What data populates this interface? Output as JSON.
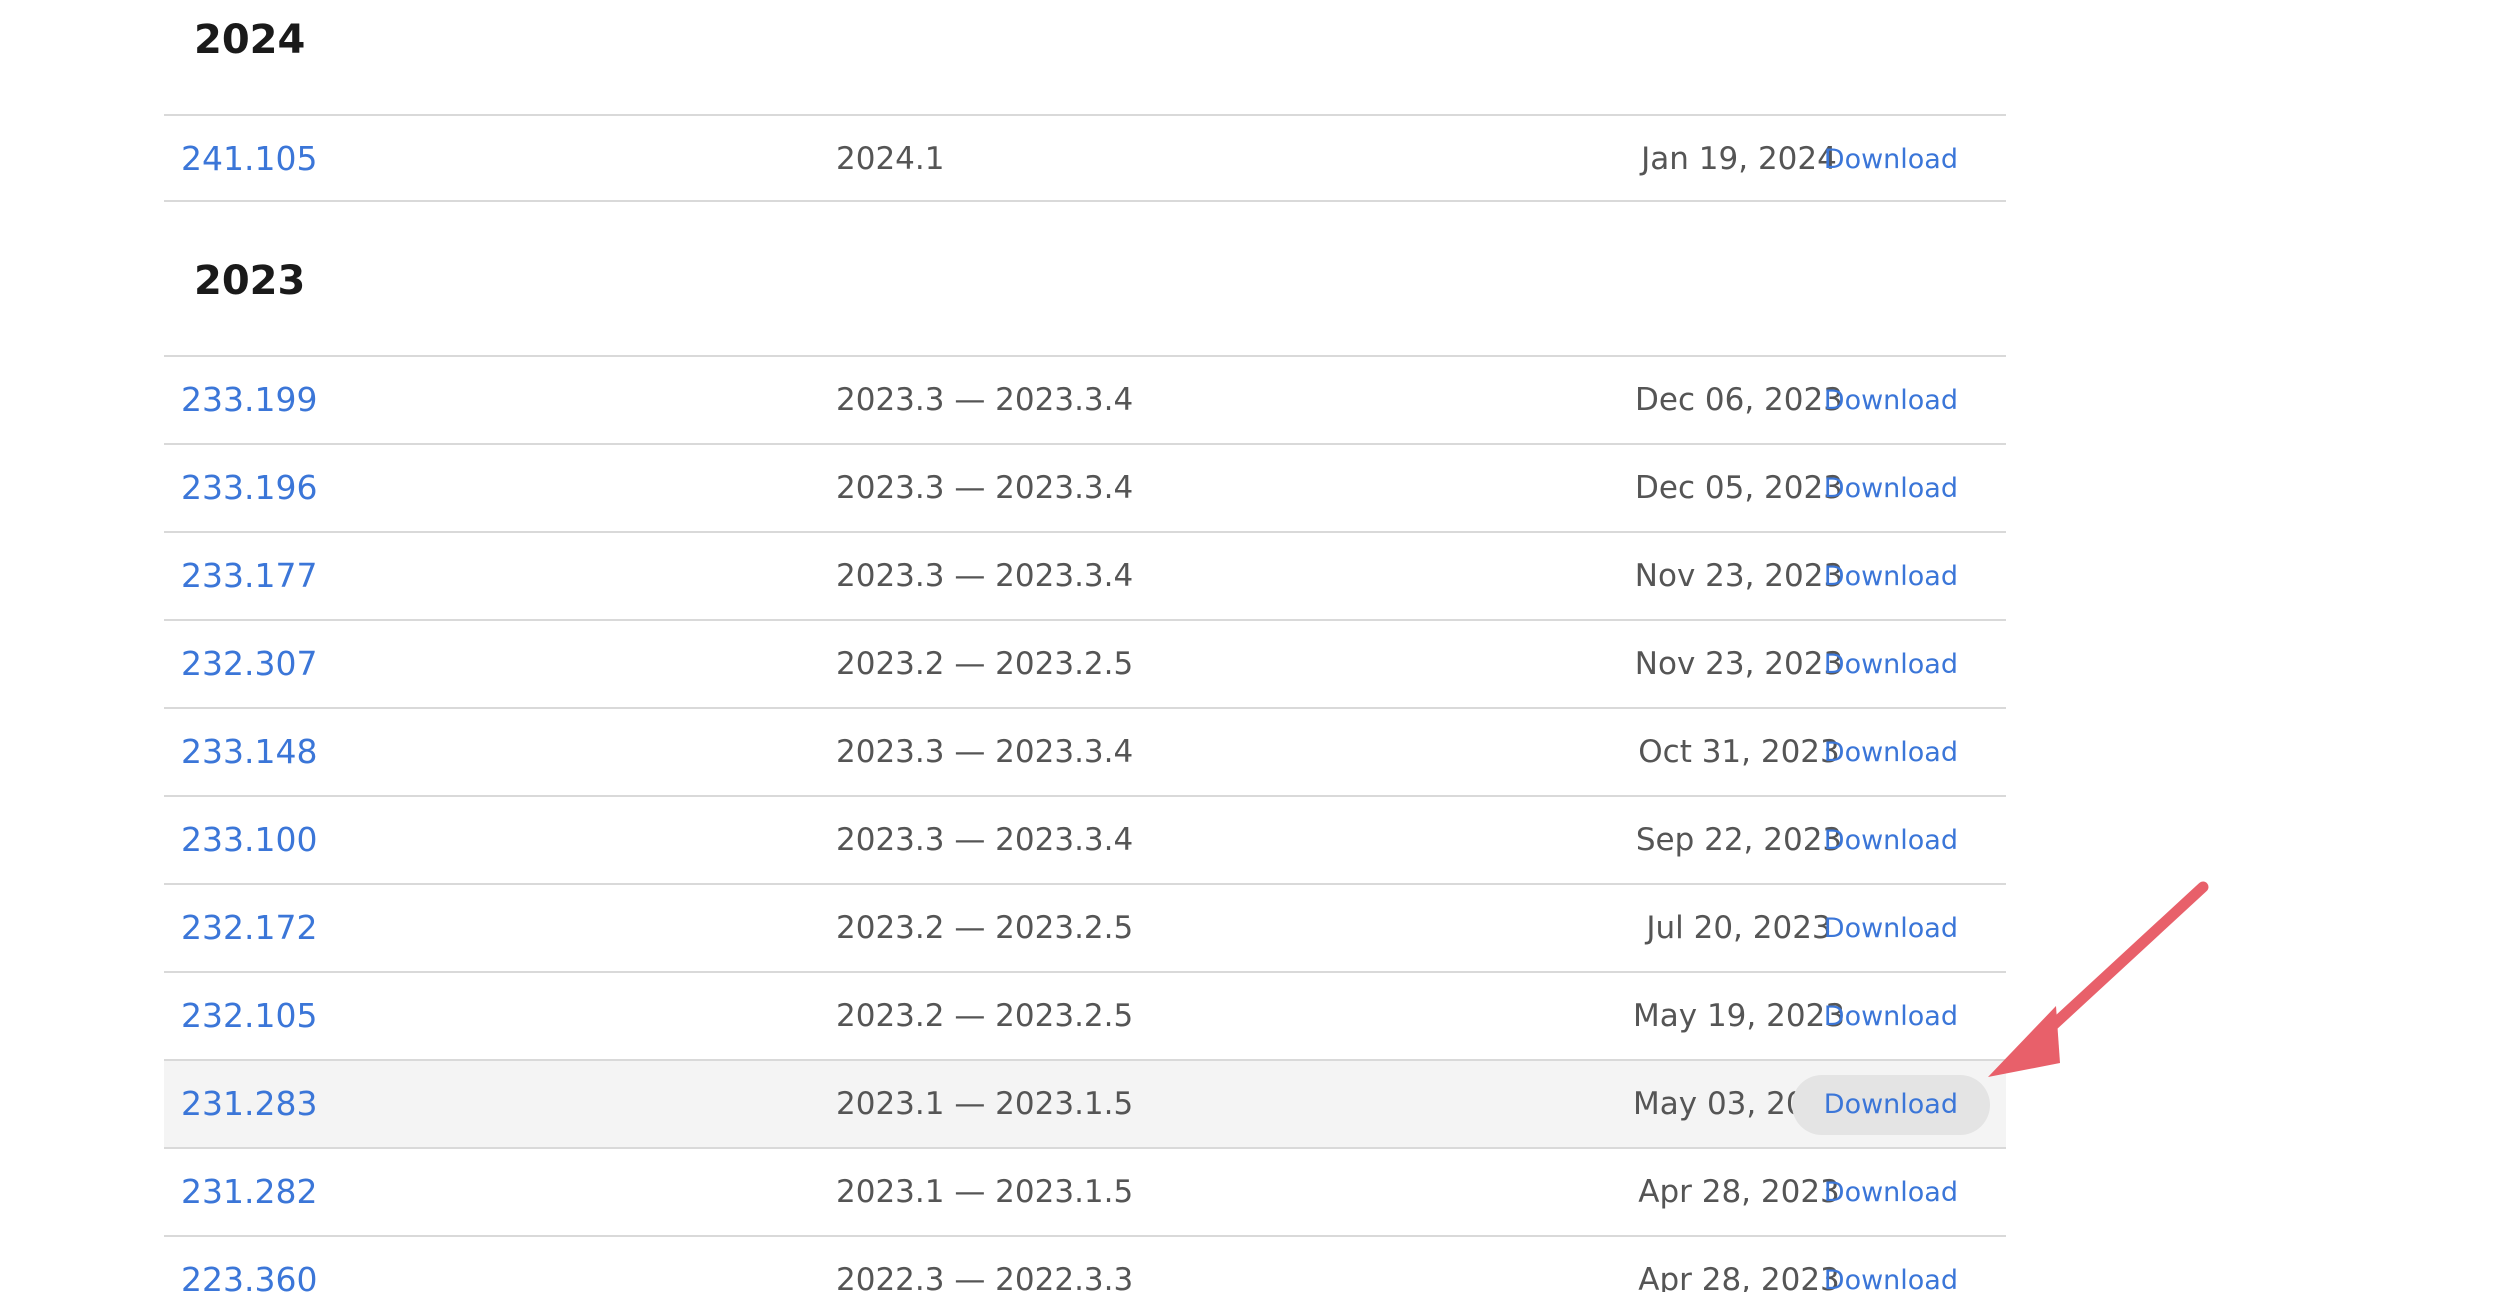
{
  "sections": [
    {
      "year": "2024",
      "rows": [
        {
          "build": "241.105",
          "version": "2024.1",
          "date": "Jan 19, 2024",
          "action": "Download"
        }
      ]
    },
    {
      "year": "2023",
      "rows": [
        {
          "build": "233.199",
          "version": "2023.3 — 2023.3.4",
          "date": "Dec 06, 2023",
          "action": "Download"
        },
        {
          "build": "233.196",
          "version": "2023.3 — 2023.3.4",
          "date": "Dec 05, 2023",
          "action": "Download"
        },
        {
          "build": "233.177",
          "version": "2023.3 — 2023.3.4",
          "date": "Nov 23, 2023",
          "action": "Download"
        },
        {
          "build": "232.307",
          "version": "2023.2 — 2023.2.5",
          "date": "Nov 23, 2023",
          "action": "Download"
        },
        {
          "build": "233.148",
          "version": "2023.3 — 2023.3.4",
          "date": "Oct 31, 2023",
          "action": "Download"
        },
        {
          "build": "233.100",
          "version": "2023.3 — 2023.3.4",
          "date": "Sep 22, 2023",
          "action": "Download"
        },
        {
          "build": "232.172",
          "version": "2023.2 — 2023.2.5",
          "date": "Jul 20, 2023",
          "action": "Download"
        },
        {
          "build": "232.105",
          "version": "2023.2 — 2023.2.5",
          "date": "May 19, 2023",
          "action": "Download"
        },
        {
          "build": "231.283",
          "version": "2023.1 — 2023.1.5",
          "date": "May 03, 2023",
          "action": "Download",
          "highlighted": true
        },
        {
          "build": "231.282",
          "version": "2023.1 — 2023.1.5",
          "date": "Apr 28, 2023",
          "action": "Download"
        },
        {
          "build": "223.360",
          "version": "2022.3 — 2022.3.3",
          "date": "Apr 28, 2023",
          "action": "Download"
        }
      ]
    }
  ],
  "colors": {
    "link": "#3b76d8",
    "text": "#555555",
    "heading": "#1a1a1a",
    "divider": "#d9d9d9",
    "highlight_row": "#f4f4f4",
    "annotation_arrow": "#e8606a"
  },
  "annotation": {
    "type": "arrow",
    "points_to": "download-button for build 231.283"
  }
}
